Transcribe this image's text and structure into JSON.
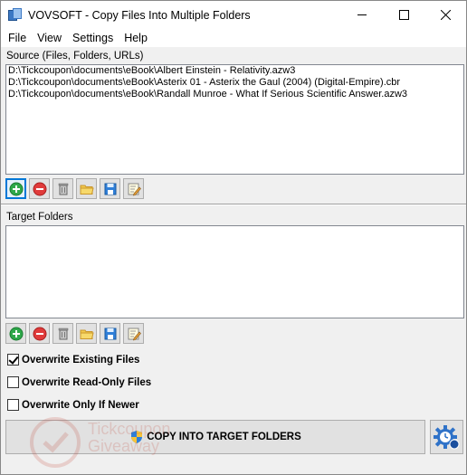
{
  "window": {
    "title": "VOVSOFT - Copy Files Into Multiple Folders"
  },
  "menu": {
    "items": [
      "File",
      "View",
      "Settings",
      "Help"
    ]
  },
  "source": {
    "label": "Source (Files, Folders, URLs)",
    "items": [
      "D:\\Tickcoupon\\documents\\eBook\\Albert Einstein - Relativity.azw3",
      "D:\\Tickcoupon\\documents\\eBook\\Asterix 01 - Asterix the Gaul (2004) (Digital-Empire).cbr",
      "D:\\Tickcoupon\\documents\\eBook\\Randall Munroe - What If Serious Scientific Answer.azw3"
    ]
  },
  "target": {
    "label": "Target Folders",
    "items": []
  },
  "options": {
    "overwrite_existing": {
      "label": "Overwrite Existing Files",
      "checked": true
    },
    "overwrite_readonly": {
      "label": "Overwrite Read-Only Files",
      "checked": false
    },
    "overwrite_newer": {
      "label": "Overwrite Only If Newer",
      "checked": false
    }
  },
  "actions": {
    "copy_label": "COPY INTO TARGET FOLDERS"
  },
  "watermark": {
    "line1": "Tickcoupon",
    "line2": "Giveaway"
  },
  "icons": {
    "add": "add-icon",
    "remove": "remove-icon",
    "clear": "trash-icon",
    "open": "folder-open-icon",
    "save": "save-icon",
    "edit": "edit-icon"
  }
}
